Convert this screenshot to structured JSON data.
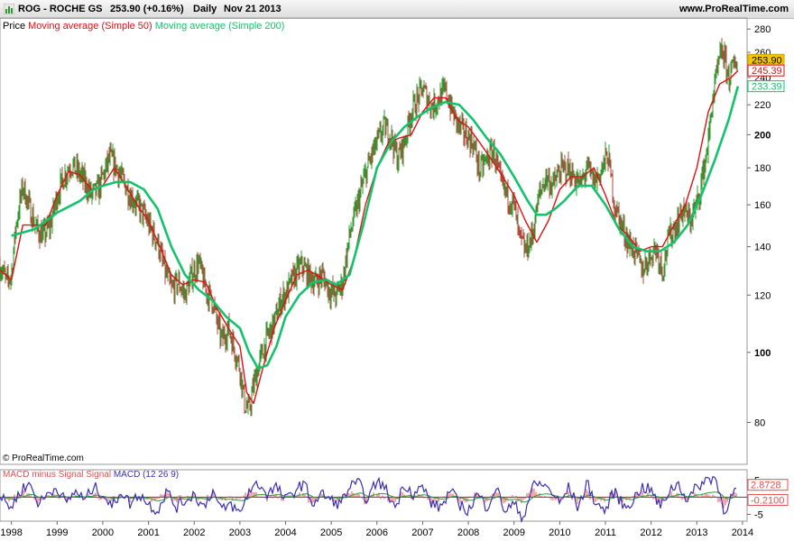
{
  "header": {
    "symbol": "ROG - ROCHE GS",
    "price_change": "253.90 (+0.16%)",
    "period": "Daily",
    "date": "Nov 21 2013",
    "site": "www.ProRealTime.com"
  },
  "icons": {
    "logo": "bar-chart-icon"
  },
  "colors": {
    "price_up": "#2e9a2e",
    "price_down": "#b04a3a",
    "sma50": "#e01010",
    "sma200": "#13c36b",
    "macd": "#3a2fb8",
    "macd_hist": "#e05050",
    "signal": "#30a030",
    "last_price_bg": "#f5c400"
  },
  "legend_main": {
    "price": "Price",
    "sma50": "Moving average (Simple 50)",
    "sma200": "Moving average (Simple 200)"
  },
  "legend_macd": {
    "hist": "MACD minus Signal Signal",
    "macd": "MACD (12 26 9)"
  },
  "watermark": "© ProRealTime.com",
  "chart_data": [
    {
      "type": "line",
      "scale": "log",
      "title": "",
      "ylim": [
        70,
        290
      ],
      "y_ticks": [
        "80",
        "100",
        "120",
        "140",
        "160",
        "180",
        "200",
        "220",
        "240",
        "260",
        "280"
      ],
      "x_labels": [
        "1998",
        "1999",
        "2000",
        "2001",
        "2002",
        "2003",
        "2004",
        "2005",
        "2006",
        "2007",
        "2008",
        "2009",
        "2010",
        "2011",
        "2012",
        "2013",
        "2014"
      ],
      "xlim": [
        1997.75,
        2014.1
      ],
      "last_values": {
        "price": "253.90",
        "sma50": "245.39",
        "sma200": "233.39"
      },
      "series": [
        {
          "name": "Price",
          "x": [
            1997.75,
            1997.9,
            1998.0,
            1998.1,
            1998.25,
            1998.4,
            1998.55,
            1998.7,
            1998.85,
            1999.0,
            1999.15,
            1999.3,
            1999.45,
            1999.6,
            1999.75,
            1999.9,
            2000.0,
            2000.15,
            2000.3,
            2000.45,
            2000.6,
            2000.75,
            2000.9,
            2001.05,
            2001.2,
            2001.35,
            2001.5,
            2001.65,
            2001.8,
            2001.95,
            2002.1,
            2002.25,
            2002.4,
            2002.5,
            2002.6,
            2002.75,
            2002.9,
            2003.0,
            2003.1,
            2003.2,
            2003.3,
            2003.45,
            2003.6,
            2003.75,
            2003.9,
            2004.05,
            2004.2,
            2004.35,
            2004.5,
            2004.65,
            2004.8,
            2004.95,
            2005.1,
            2005.25,
            2005.4,
            2005.55,
            2005.7,
            2005.85,
            2006.0,
            2006.15,
            2006.3,
            2006.45,
            2006.6,
            2006.75,
            2006.9,
            2007.0,
            2007.1,
            2007.2,
            2007.35,
            2007.5,
            2007.65,
            2007.8,
            2007.95,
            2008.1,
            2008.25,
            2008.4,
            2008.55,
            2008.7,
            2008.85,
            2009.0,
            2009.1,
            2009.25,
            2009.4,
            2009.55,
            2009.7,
            2009.85,
            2010.0,
            2010.15,
            2010.3,
            2010.45,
            2010.6,
            2010.75,
            2010.9,
            2011.05,
            2011.2,
            2011.35,
            2011.5,
            2011.65,
            2011.8,
            2011.95,
            2012.1,
            2012.25,
            2012.4,
            2012.55,
            2012.7,
            2012.85,
            2013.0,
            2013.1,
            2013.25,
            2013.35,
            2013.45,
            2013.55,
            2013.7,
            2013.8,
            2013.9
          ],
          "values": [
            132,
            125,
            128,
            150,
            170,
            158,
            148,
            145,
            150,
            165,
            175,
            182,
            178,
            172,
            165,
            168,
            175,
            186,
            180,
            172,
            165,
            160,
            155,
            148,
            142,
            130,
            122,
            125,
            120,
            128,
            133,
            122,
            118,
            110,
            104,
            108,
            100,
            95,
            85,
            83,
            90,
            98,
            105,
            110,
            118,
            122,
            128,
            132,
            128,
            125,
            128,
            122,
            120,
            125,
            145,
            158,
            172,
            185,
            195,
            205,
            200,
            185,
            195,
            215,
            225,
            232,
            225,
            218,
            225,
            230,
            215,
            205,
            200,
            195,
            178,
            185,
            190,
            172,
            165,
            160,
            145,
            138,
            145,
            165,
            175,
            170,
            178,
            180,
            175,
            170,
            180,
            172,
            178,
            188,
            160,
            150,
            142,
            138,
            130,
            135,
            140,
            130,
            145,
            150,
            158,
            152,
            160,
            172,
            195,
            225,
            245,
            262,
            240,
            248,
            253.9
          ],
          "color": "price_up"
        },
        {
          "name": "Moving average (Simple 50)",
          "x": [
            1997.75,
            1998.0,
            1998.25,
            1998.5,
            1998.75,
            1999.0,
            1999.25,
            1999.5,
            1999.75,
            2000.0,
            2000.25,
            2000.5,
            2000.75,
            2001.0,
            2001.25,
            2001.5,
            2001.75,
            2002.0,
            2002.25,
            2002.5,
            2002.75,
            2003.0,
            2003.15,
            2003.3,
            2003.5,
            2003.75,
            2004.0,
            2004.25,
            2004.5,
            2004.75,
            2005.0,
            2005.25,
            2005.5,
            2005.75,
            2006.0,
            2006.25,
            2006.5,
            2006.75,
            2007.0,
            2007.25,
            2007.5,
            2007.75,
            2008.0,
            2008.25,
            2008.5,
            2008.75,
            2009.0,
            2009.25,
            2009.5,
            2009.75,
            2010.0,
            2010.25,
            2010.5,
            2010.75,
            2011.0,
            2011.25,
            2011.5,
            2011.75,
            2012.0,
            2012.25,
            2012.5,
            2012.75,
            2013.0,
            2013.25,
            2013.5,
            2013.75,
            2013.9
          ],
          "values": [
            130,
            126,
            150,
            150,
            150,
            165,
            178,
            176,
            168,
            170,
            180,
            170,
            160,
            152,
            140,
            128,
            124,
            126,
            125,
            115,
            108,
            102,
            88,
            85,
            95,
            108,
            118,
            128,
            130,
            127,
            124,
            122,
            135,
            160,
            180,
            195,
            198,
            200,
            215,
            225,
            225,
            210,
            205,
            195,
            185,
            175,
            165,
            152,
            142,
            152,
            168,
            175,
            175,
            180,
            165,
            150,
            145,
            138,
            140,
            140,
            150,
            160,
            180,
            215,
            235,
            240,
            245.39
          ],
          "color": "sma50"
        },
        {
          "name": "Moving average (Simple 200)",
          "x": [
            1998.0,
            1998.5,
            1999.0,
            1999.5,
            1999.8,
            2000.0,
            2000.3,
            2000.6,
            2000.9,
            2001.2,
            2001.5,
            2001.8,
            2002.1,
            2002.4,
            2002.7,
            2003.0,
            2003.2,
            2003.4,
            2003.6,
            2003.8,
            2004.0,
            2004.3,
            2004.6,
            2004.9,
            2005.1,
            2005.4,
            2005.7,
            2006.0,
            2006.3,
            2006.6,
            2006.9,
            2007.2,
            2007.5,
            2007.8,
            2008.1,
            2008.4,
            2008.7,
            2009.0,
            2009.3,
            2009.5,
            2009.7,
            2009.9,
            2010.1,
            2010.4,
            2010.7,
            2011.0,
            2011.3,
            2011.6,
            2011.9,
            2012.2,
            2012.5,
            2012.8,
            2013.1,
            2013.4,
            2013.7,
            2013.9
          ],
          "values": [
            145,
            148,
            156,
            162,
            168,
            170,
            172,
            172,
            168,
            158,
            140,
            128,
            122,
            118,
            112,
            108,
            100,
            95,
            96,
            102,
            112,
            120,
            125,
            126,
            124,
            128,
            150,
            180,
            195,
            205,
            212,
            218,
            222,
            220,
            210,
            198,
            188,
            175,
            162,
            155,
            155,
            158,
            162,
            170,
            170,
            160,
            148,
            140,
            138,
            138,
            142,
            150,
            165,
            185,
            210,
            233.39
          ],
          "color": "sma200"
        }
      ]
    },
    {
      "type": "line",
      "title": "MACD (12 26 9)",
      "ylim": [
        -7,
        8
      ],
      "y_ticks": [
        "5",
        "-5"
      ],
      "last_values": {
        "macd": "2.8728",
        "hist": "-0.2100"
      },
      "series": [
        {
          "name": "MACD (12 26 9)",
          "x": [
            1997.75,
            1998.0,
            1998.2,
            1998.4,
            1998.6,
            1998.8,
            1999.0,
            1999.2,
            1999.4,
            1999.6,
            1999.8,
            2000.0,
            2000.2,
            2000.4,
            2000.6,
            2000.8,
            2001.0,
            2001.2,
            2001.4,
            2001.6,
            2001.8,
            2002.0,
            2002.2,
            2002.4,
            2002.6,
            2002.8,
            2003.0,
            2003.2,
            2003.4,
            2003.6,
            2003.8,
            2004.0,
            2004.2,
            2004.4,
            2004.6,
            2004.8,
            2005.0,
            2005.2,
            2005.4,
            2005.6,
            2005.8,
            2006.0,
            2006.2,
            2006.4,
            2006.6,
            2006.8,
            2007.0,
            2007.2,
            2007.4,
            2007.6,
            2007.8,
            2008.0,
            2008.2,
            2008.4,
            2008.6,
            2008.8,
            2009.0,
            2009.2,
            2009.4,
            2009.6,
            2009.8,
            2010.0,
            2010.2,
            2010.4,
            2010.6,
            2010.8,
            2011.0,
            2011.2,
            2011.4,
            2011.6,
            2011.8,
            2012.0,
            2012.2,
            2012.4,
            2012.6,
            2012.8,
            2013.0,
            2013.2,
            2013.4,
            2013.6,
            2013.8,
            2013.9
          ],
          "values": [
            0,
            -3,
            2,
            4,
            -2,
            1,
            3,
            -2,
            2,
            -1,
            3,
            1,
            -3,
            2,
            -2,
            1,
            -2,
            -4,
            2,
            -3,
            -1,
            1,
            -3,
            2,
            -4,
            -2,
            -5,
            2,
            4,
            1,
            3,
            -1,
            2,
            4,
            -2,
            1,
            -1,
            -2,
            3,
            4,
            -1,
            5,
            2,
            -3,
            4,
            1,
            3,
            -2,
            -3,
            2,
            -2,
            -4,
            1,
            -3,
            3,
            -4,
            -2,
            -6,
            3,
            4,
            2,
            -2,
            3,
            -3,
            4,
            -2,
            -4,
            2,
            -3,
            -1,
            3,
            2,
            -3,
            2,
            4,
            -1,
            3,
            5,
            6,
            -4,
            1,
            2.8728
          ],
          "color": "macd"
        }
      ]
    }
  ]
}
